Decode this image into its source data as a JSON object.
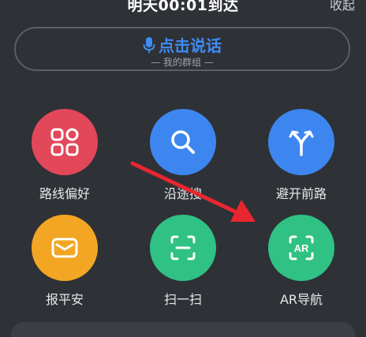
{
  "header": {
    "arrival_text": "明天00:01到达",
    "collapse_label": "收起"
  },
  "voice": {
    "label": "点击说话",
    "sub_label": "— 我的群组 —"
  },
  "functions": [
    {
      "label": "路线偏好",
      "color": "#e2475a",
      "icon": "grid-icon"
    },
    {
      "label": "沿途搜",
      "color": "#3d86f0",
      "icon": "search-icon"
    },
    {
      "label": "避开前路",
      "color": "#3d86f0",
      "icon": "fork-arrow-icon"
    },
    {
      "label": "报平安",
      "color": "#f2a623",
      "icon": "envelope-icon"
    },
    {
      "label": "扫一扫",
      "color": "#30c184",
      "icon": "scan-icon"
    },
    {
      "label": "AR导航",
      "color": "#30c184",
      "icon": "ar-icon"
    }
  ],
  "annotation": {
    "arrow_color": "#e8262f"
  }
}
